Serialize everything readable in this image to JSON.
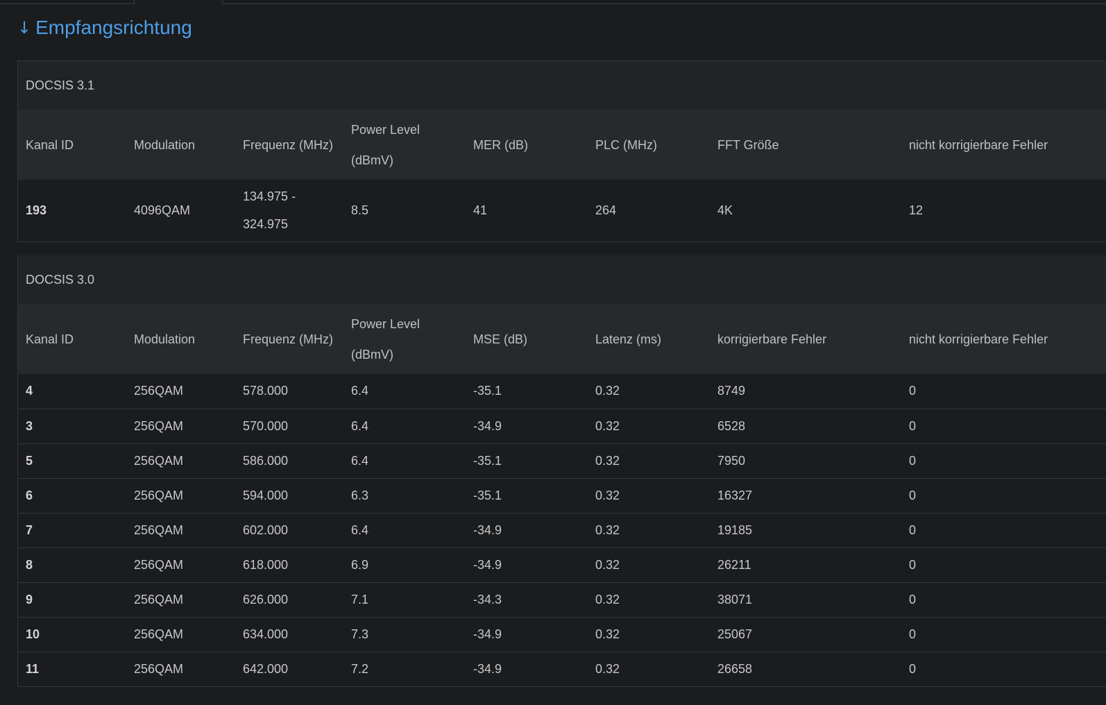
{
  "heading": {
    "icon": "arrow-down-icon",
    "title": "Empfangsrichtung"
  },
  "docsis31": {
    "title": "DOCSIS 3.1",
    "headers": [
      "Kanal ID",
      "Modulation",
      "Frequenz (MHz)",
      "Power Level (dBmV)",
      "MER (dB)",
      "PLC (MHz)",
      "FFT Größe",
      "nicht korrigierbare Fehler"
    ],
    "rows": [
      [
        "193",
        "4096QAM",
        "134.975 - 324.975",
        "8.5",
        "41",
        "264",
        "4K",
        "12"
      ]
    ]
  },
  "docsis30": {
    "title": "DOCSIS 3.0",
    "headers": [
      "Kanal ID",
      "Modulation",
      "Frequenz (MHz)",
      "Power Level (dBmV)",
      "MSE (dB)",
      "Latenz (ms)",
      "korrigierbare Fehler",
      "nicht korrigierbare Fehler"
    ],
    "rows": [
      [
        "4",
        "256QAM",
        "578.000",
        "6.4",
        "-35.1",
        "0.32",
        "8749",
        "0"
      ],
      [
        "3",
        "256QAM",
        "570.000",
        "6.4",
        "-34.9",
        "0.32",
        "6528",
        "0"
      ],
      [
        "5",
        "256QAM",
        "586.000",
        "6.4",
        "-35.1",
        "0.32",
        "7950",
        "0"
      ],
      [
        "6",
        "256QAM",
        "594.000",
        "6.3",
        "-35.1",
        "0.32",
        "16327",
        "0"
      ],
      [
        "7",
        "256QAM",
        "602.000",
        "6.4",
        "-34.9",
        "0.32",
        "19185",
        "0"
      ],
      [
        "8",
        "256QAM",
        "618.000",
        "6.9",
        "-34.9",
        "0.32",
        "26211",
        "0"
      ],
      [
        "9",
        "256QAM",
        "626.000",
        "7.1",
        "-34.3",
        "0.32",
        "38071",
        "0"
      ],
      [
        "10",
        "256QAM",
        "634.000",
        "7.3",
        "-34.9",
        "0.32",
        "25067",
        "0"
      ],
      [
        "11",
        "256QAM",
        "642.000",
        "7.2",
        "-34.9",
        "0.32",
        "26658",
        "0"
      ]
    ]
  },
  "colors": {
    "accent": "#4e9ee6",
    "background": "#1b1c1e",
    "header_row": "#262a2c"
  }
}
